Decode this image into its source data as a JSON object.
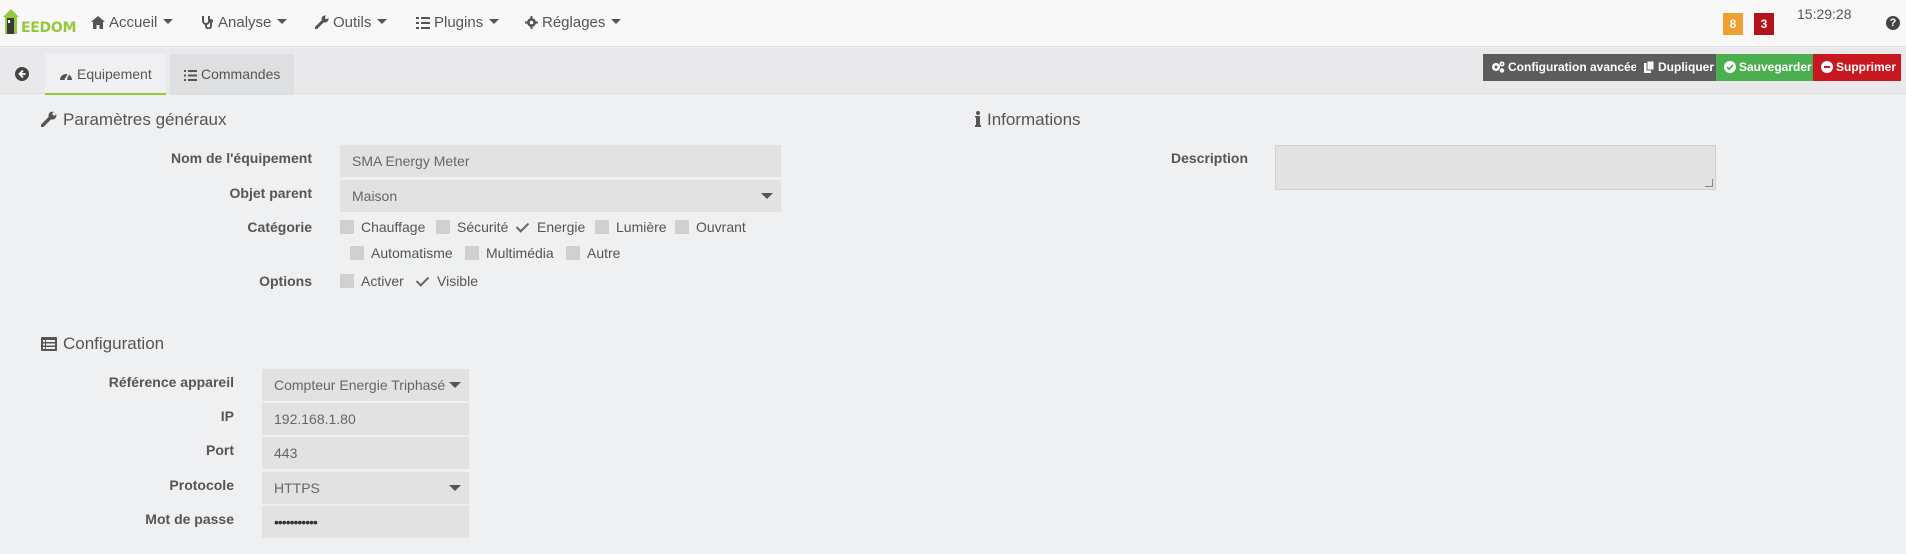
{
  "navbar": {
    "logo_text": "EEDOM",
    "items": [
      {
        "label": "Accueil",
        "icon": "home-icon"
      },
      {
        "label": "Analyse",
        "icon": "stethoscope-icon"
      },
      {
        "label": "Outils",
        "icon": "wrench-icon"
      },
      {
        "label": "Plugins",
        "icon": "list-check-icon"
      },
      {
        "label": "Réglages",
        "icon": "gear-icon"
      }
    ],
    "badge_warning": "8",
    "badge_alert": "3",
    "clock": "15:29:28",
    "help_icon": "question-icon",
    "colors": {
      "warning": "#f0a030",
      "alert": "#b3121b",
      "brand": "#94c83d"
    }
  },
  "tabs": [
    {
      "label": "Equipement",
      "icon": "dashboard-icon",
      "active": true
    },
    {
      "label": "Commandes",
      "icon": "list-icon",
      "active": false
    }
  ],
  "actions": [
    {
      "label": "Configuration avancée",
      "icon": "cogs-icon",
      "color": "#5c5c5c"
    },
    {
      "label": "Dupliquer",
      "icon": "copy-icon",
      "color": "#5c5c5c"
    },
    {
      "label": "Sauvegarder",
      "icon": "check-circle-icon",
      "color": "#4bae4f"
    },
    {
      "label": "Supprimer",
      "icon": "minus-circle-icon",
      "color": "#c9171f"
    }
  ],
  "general": {
    "title": "Paramètres généraux",
    "name_label": "Nom de l'équipement",
    "name_value": "SMA Energy Meter",
    "parent_label": "Objet parent",
    "parent_value": "Maison",
    "category_label": "Catégorie",
    "categories": [
      {
        "label": "Chauffage",
        "checked": false
      },
      {
        "label": "Sécurité",
        "checked": false
      },
      {
        "label": "Energie",
        "checked": true
      },
      {
        "label": "Lumière",
        "checked": false
      },
      {
        "label": "Ouvrant",
        "checked": false
      },
      {
        "label": "Automatisme",
        "checked": false
      },
      {
        "label": "Multimédia",
        "checked": false
      },
      {
        "label": "Autre",
        "checked": false
      }
    ],
    "options_label": "Options",
    "options": [
      {
        "label": "Activer",
        "checked": false
      },
      {
        "label": "Visible",
        "checked": true
      }
    ]
  },
  "informations": {
    "title": "Informations",
    "description_label": "Description",
    "description_value": ""
  },
  "configuration": {
    "title": "Configuration",
    "ref_label": "Référence appareil",
    "ref_value": "Compteur Energie Triphasé",
    "ip_label": "IP",
    "ip_value": "192.168.1.80",
    "port_label": "Port",
    "port_value": "443",
    "protocol_label": "Protocole",
    "protocol_value": "HTTPS",
    "password_label": "Mot de passe",
    "password_value": "•••••••••••"
  }
}
